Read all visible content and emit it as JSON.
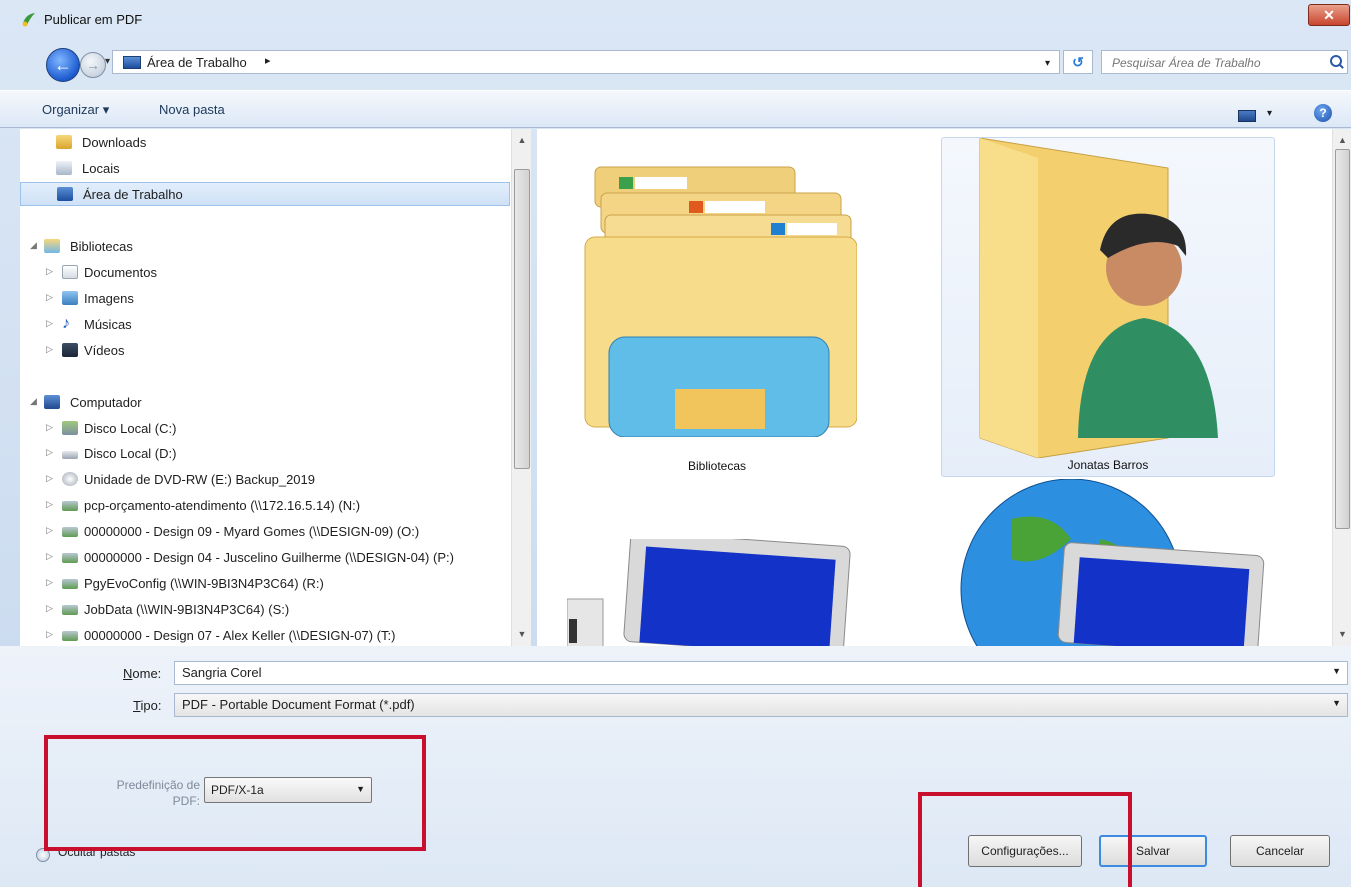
{
  "window": {
    "title": "Publicar em PDF",
    "close_label": "✕"
  },
  "address": {
    "path": "Área de Trabalho",
    "separator": "▸"
  },
  "search": {
    "placeholder": "Pesquisar Área de Trabalho"
  },
  "toolbar": {
    "organize": "Organizar ▾",
    "new_folder": "Nova pasta",
    "help": "?"
  },
  "nav_items": [
    {
      "label": "Downloads"
    },
    {
      "label": "Locais"
    },
    {
      "label": "Área de Trabalho"
    },
    {
      "label": "Bibliotecas"
    },
    {
      "label": "Documentos"
    },
    {
      "label": "Imagens"
    },
    {
      "label": "Músicas"
    },
    {
      "label": "Vídeos"
    },
    {
      "label": "Computador"
    },
    {
      "label": "Disco Local (C:)"
    },
    {
      "label": "Disco Local (D:)"
    },
    {
      "label": "Unidade de DVD-RW (E:) Backup_2019"
    },
    {
      "label": "pcp-orçamento-atendimento (\\\\172.16.5.14) (N:)"
    },
    {
      "label": "00000000 - Design 09 - Myard Gomes (\\\\DESIGN-09) (O:)"
    },
    {
      "label": "00000000 - Design 04 - Juscelino Guilherme (\\\\DESIGN-04) (P:)"
    },
    {
      "label": "PgyEvoConfig (\\\\WIN-9BI3N4P3C64) (R:)"
    },
    {
      "label": "JobData (\\\\WIN-9BI3N4P3C64) (S:)"
    },
    {
      "label": "00000000 - Design 07 - Alex Keller (\\\\DESIGN-07) (T:)"
    }
  ],
  "tiles": [
    {
      "label": "Bibliotecas"
    },
    {
      "label": "Jonatas Barros"
    }
  ],
  "form": {
    "name_label": "Nome:",
    "name_label_accel": "N",
    "name_label_rest": "ome:",
    "name_value": "Sangria Corel",
    "type_label": "Tipo:",
    "type_label_accel": "T",
    "type_label_rest": "ipo:",
    "type_value": "PDF - Portable Document Format (*.pdf)",
    "preset_label": "Predefinição de PDF:",
    "preset_label_line1": "Predefinição de",
    "preset_label_line2": "PDF:",
    "preset_value": "PDF/X-1a"
  },
  "buttons": {
    "hide_folders": "Ocultar pastas",
    "settings": "Configurações...",
    "save": "Salvar",
    "cancel": "Cancelar"
  },
  "colors": {
    "highlight_box": "#c8102e",
    "selection": "#cfe1f6",
    "accent": "#3c8be0"
  }
}
